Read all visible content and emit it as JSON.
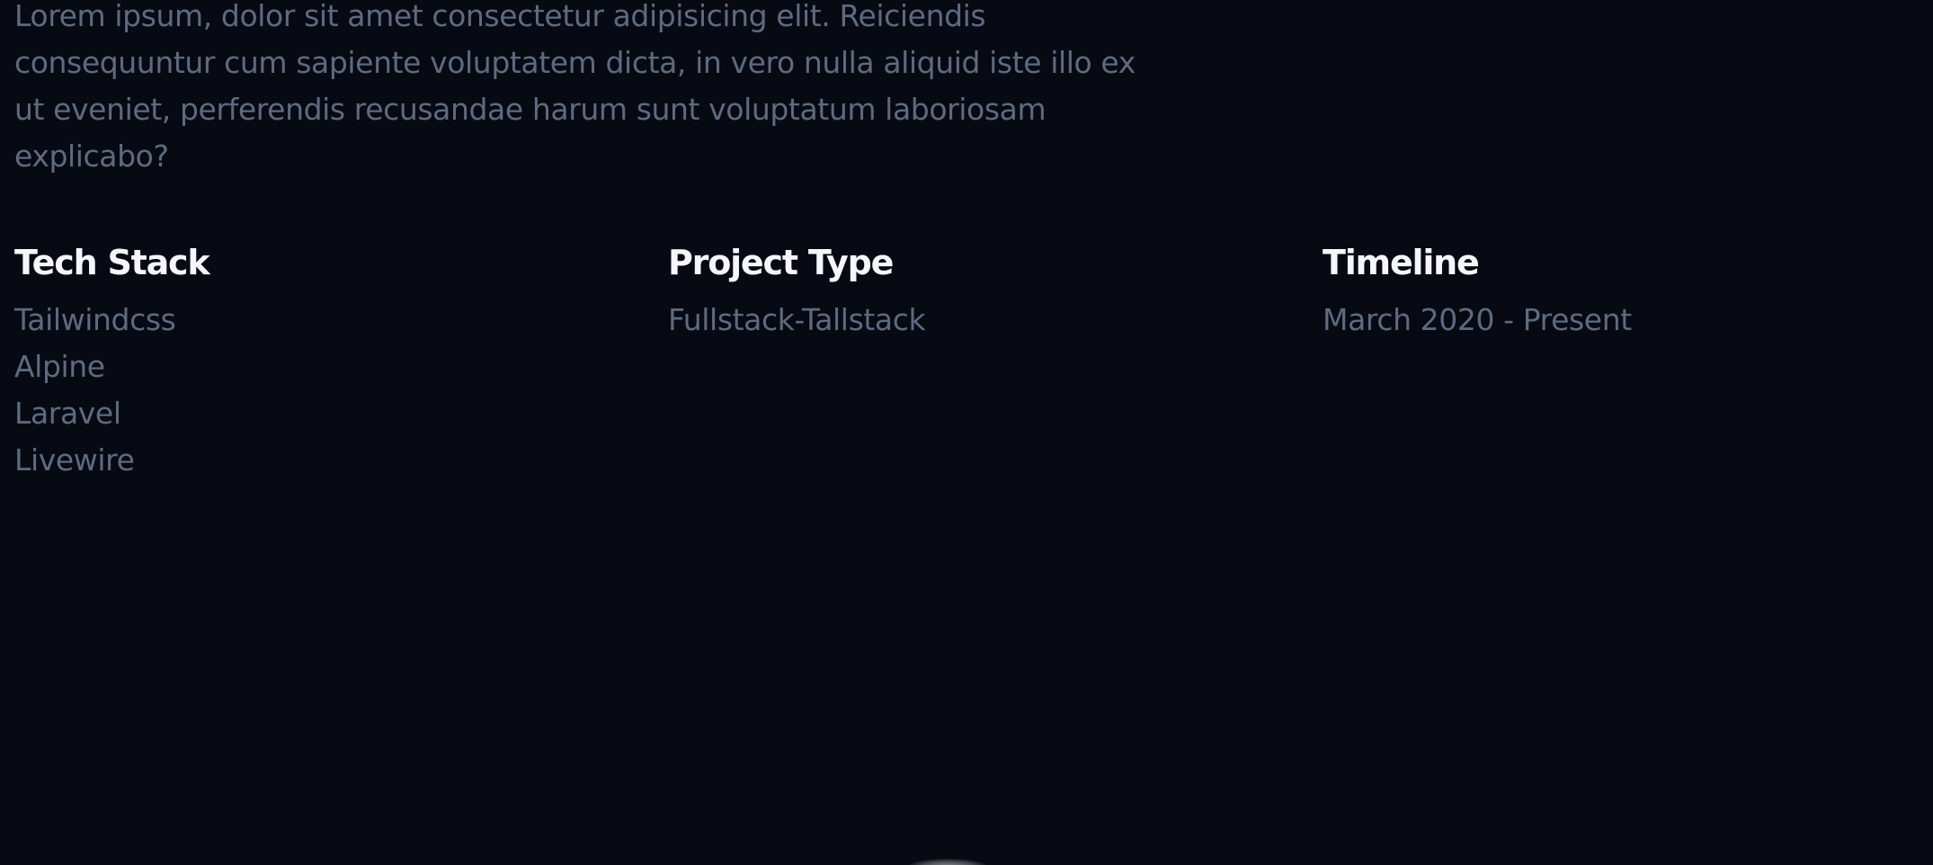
{
  "intro": {
    "text": "Lorem ipsum, dolor sit amet consectetur adipisicing elit. Reiciendis consequuntur cum sapiente voluptatem dicta, in vero nulla aliquid iste illo ex ut eveniet, perferendis recusandae harum sunt voluptatum laboriosam explicabo?"
  },
  "tech_stack": {
    "title": "Tech Stack",
    "items": [
      "Tailwindcss",
      "Alpine",
      "Laravel",
      "Livewire"
    ]
  },
  "project_type": {
    "title": "Project Type",
    "value": "Fullstack-Tallstack"
  },
  "timeline": {
    "title": "Timeline",
    "value": "March 2020 - Present"
  },
  "colors": {
    "background": "#070a12",
    "heading": "#f4f6fb",
    "muted_text": "#5f6a80"
  }
}
